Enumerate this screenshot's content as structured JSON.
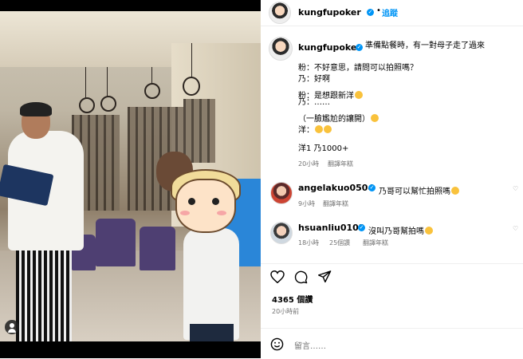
{
  "post": {
    "author": "kungfupoker",
    "follow_label": "追蹤",
    "caption_lines": [
      "準備點餐時，有一對母子走了過來",
      "",
      "粉：不好意思，請問可以拍照嗎？",
      "乃：好啊",
      "粉：是想跟新洋",
      "乃：……",
      "（一臉尷尬的讓開）",
      "洋：",
      "",
      "洋1 乃1000+"
    ],
    "caption_time": "20小時",
    "translate_label": "翻譯年糕",
    "likes": "4365 個讚",
    "posted_ago": "20小時前",
    "comment_placeholder": "留言……"
  },
  "comments": [
    {
      "user": "angelakuo0504",
      "text": "乃哥可以幫忙拍照嗎",
      "time": "9小時",
      "likes": "",
      "translate": "翻譯年糕"
    },
    {
      "user": "hsuanliu0103",
      "text": "沒叫乃哥幫拍嗎",
      "time": "18小時",
      "likes": "25個讚",
      "translate": "翻譯年糕"
    }
  ],
  "icons": [
    "verified-badge-icon",
    "heart-icon",
    "comment-icon",
    "share-icon",
    "emoji-icon",
    "user-tag-icon"
  ],
  "colors": {
    "accent": "#0095f6",
    "meta": "#737373"
  }
}
